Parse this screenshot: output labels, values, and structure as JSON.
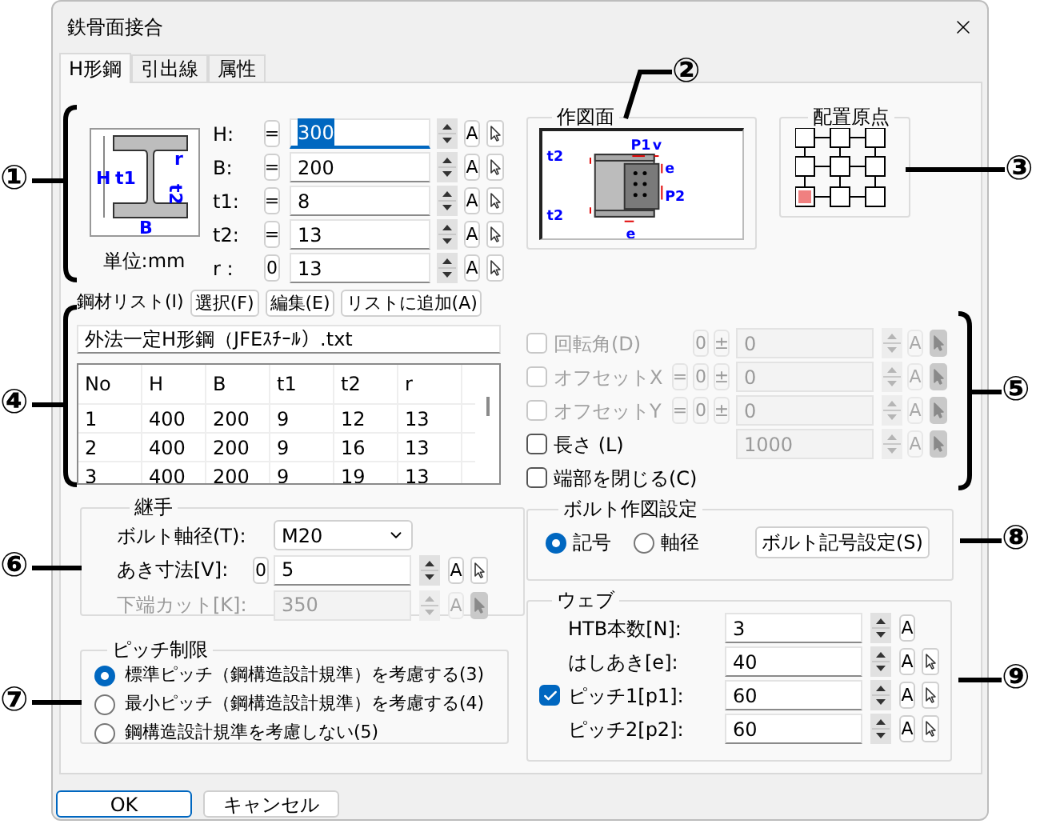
{
  "window": {
    "title": "鉄骨面接合"
  },
  "tabs": [
    {
      "label": "H形鋼",
      "selected": true
    },
    {
      "label": "引出線",
      "selected": false
    },
    {
      "label": "属性",
      "selected": false
    }
  ],
  "dimensions": {
    "diagram_labels": [
      "H",
      "t1",
      "r",
      "t2",
      "B"
    ],
    "unit": "単位:mm",
    "rows": [
      {
        "label": "H:",
        "mode": "=",
        "value": "300",
        "focused": true,
        "auto": "A"
      },
      {
        "label": "B:",
        "mode": "=",
        "value": "200",
        "focused": false,
        "auto": "A"
      },
      {
        "label": "t1:",
        "mode": "=",
        "value": "8",
        "focused": false,
        "auto": "A"
      },
      {
        "label": "t2:",
        "mode": "=",
        "value": "13",
        "focused": false,
        "auto": "A"
      },
      {
        "label": "r :",
        "mode": "0",
        "value": "13",
        "focused": false,
        "auto": "A"
      }
    ]
  },
  "drawing_face": {
    "title": "作図面",
    "labels": [
      "P1",
      "v",
      "t2",
      "e",
      "P2",
      "t2",
      "e"
    ]
  },
  "placement_origin": {
    "title": "配置原点",
    "points": [
      {
        "selected": false
      },
      {
        "selected": false
      },
      {
        "selected": false
      },
      {
        "selected": false
      },
      {
        "selected": false
      },
      {
        "selected": false
      },
      {
        "selected": true
      },
      {
        "selected": false
      },
      {
        "selected": false
      }
    ]
  },
  "steel_list": {
    "label": "鋼材リスト(I)",
    "buttons": [
      "選択(F)",
      "編集(E)",
      "リストに追加(A)"
    ],
    "file": "外法一定H形鋼（JFEｽﾁｰﾙ）.txt",
    "columns": [
      "No",
      "H",
      "B",
      "t1",
      "t2",
      "r"
    ],
    "rows": [
      [
        "1",
        "400",
        "200",
        "9",
        "12",
        "13"
      ],
      [
        "2",
        "400",
        "200",
        "9",
        "16",
        "13"
      ],
      [
        "3",
        "400",
        "200",
        "9",
        "19",
        "13"
      ]
    ]
  },
  "options": [
    {
      "kind": "value",
      "label": "回転角(D)",
      "checked": false,
      "disabled": true,
      "modes": [
        "0",
        "±"
      ],
      "value": "0",
      "field_disabled": true,
      "auto": "A"
    },
    {
      "kind": "value",
      "label": "オフセットX",
      "checked": false,
      "disabled": true,
      "modes": [
        "=",
        "0",
        "±"
      ],
      "value": "0",
      "field_disabled": true,
      "auto": "A"
    },
    {
      "kind": "value",
      "label": "オフセットY",
      "checked": false,
      "disabled": true,
      "modes": [
        "=",
        "0",
        "±"
      ],
      "value": "0",
      "field_disabled": true,
      "auto": "A"
    },
    {
      "kind": "value",
      "label": "長さ (L)",
      "checked": false,
      "disabled": false,
      "value": "1000",
      "field_disabled": true,
      "auto": "A"
    },
    {
      "kind": "check",
      "label": "端部を閉じる(C)",
      "checked": false,
      "disabled": false
    }
  ],
  "joint": {
    "title": "継手",
    "bolt_diameter": {
      "label": "ボルト軸径(T):",
      "value": "M20"
    },
    "rows": [
      {
        "label": "あき寸法[V]:",
        "mode": "0",
        "value": "5",
        "disabled": false,
        "auto": "A"
      },
      {
        "label": "下端カット[K]:",
        "value": "350",
        "disabled": true,
        "auto": "A"
      }
    ]
  },
  "pitch_limit": {
    "title": "ピッチ制限",
    "options": [
      {
        "label": "標準ピッチ（鋼構造設計規準）を考慮する(3)",
        "selected": true
      },
      {
        "label": "最小ピッチ（鋼構造設計規準）を考慮する(4)",
        "selected": false
      },
      {
        "label": "鋼構造設計規準を考慮しない(5)",
        "selected": false
      }
    ]
  },
  "bolt_drawing": {
    "title": "ボルト作図設定",
    "options": [
      {
        "label": "記号",
        "selected": true
      },
      {
        "label": "軸径",
        "selected": false
      }
    ],
    "button": "ボルト記号設定(S)"
  },
  "web": {
    "title": "ウェブ",
    "rows": [
      {
        "kind": "plain",
        "label": "HTB本数[N]:",
        "value": "3",
        "auto": "A",
        "pick": false
      },
      {
        "kind": "plain",
        "label": "はしあき[e]:",
        "value": "40",
        "auto": "A",
        "pick": true
      },
      {
        "kind": "checkbox",
        "label": "ピッチ1[p1]:",
        "checked": true,
        "value": "60",
        "auto": "A",
        "pick": true
      },
      {
        "kind": "plain",
        "label": "ピッチ2[p2]:",
        "value": "60",
        "auto": "A",
        "pick": true
      }
    ]
  },
  "buttons": [
    {
      "label": "OK",
      "default": true
    },
    {
      "label": "キャンセル",
      "default": false
    }
  ],
  "callouts": [
    {
      "label": "①"
    },
    {
      "label": "②"
    },
    {
      "label": "③"
    },
    {
      "label": "④"
    },
    {
      "label": "⑤"
    },
    {
      "label": "⑥"
    },
    {
      "label": "⑦"
    },
    {
      "label": "⑧"
    },
    {
      "label": "⑨"
    }
  ]
}
